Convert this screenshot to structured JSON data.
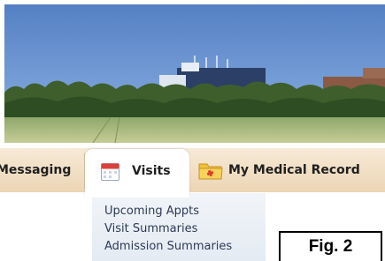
{
  "tabs": {
    "messaging": {
      "label": "Messaging",
      "icon": "envelope-icon"
    },
    "visits": {
      "label": "Visits",
      "icon": "calendar-icon",
      "active": true
    },
    "medical_record": {
      "label": "My Medical Record",
      "icon": "medical-folder-icon"
    }
  },
  "visits_menu": {
    "items": [
      {
        "label": "Upcoming Appts"
      },
      {
        "label": "Visit Summaries"
      },
      {
        "label": "Admission Summaries"
      }
    ]
  },
  "figure_label": "Fig. 2",
  "colors": {
    "tabbar": "#ecd5b4",
    "menu_text": "#2d3a55",
    "sky": "#5d87c7"
  }
}
